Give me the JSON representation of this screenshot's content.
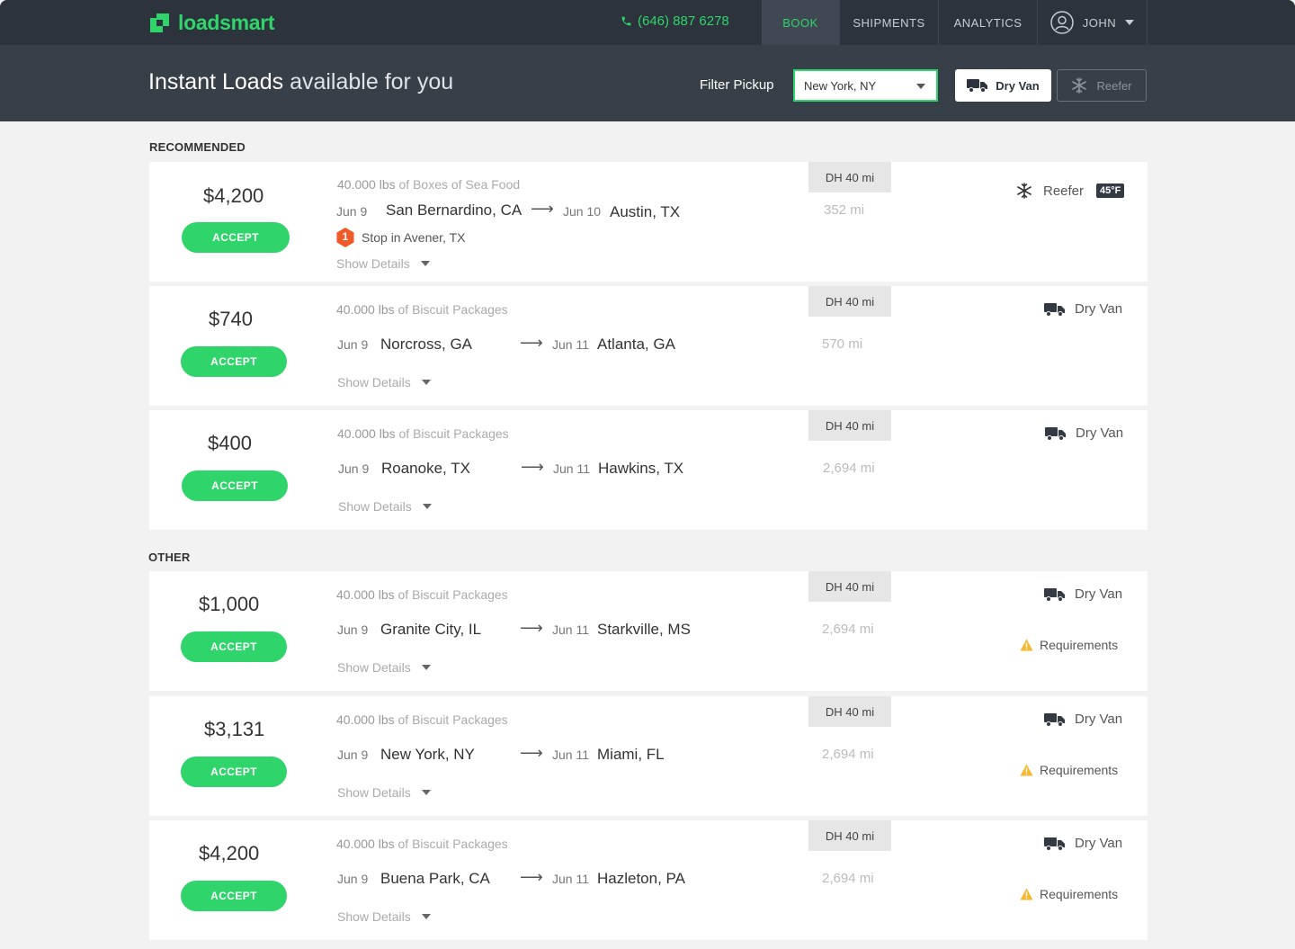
{
  "brand": {
    "name": "loadsmart",
    "color": "#2fd46a"
  },
  "header": {
    "phone": "(646) 887 6278",
    "nav": [
      "BOOK",
      "SHIPMENTS",
      "ANALYTICS"
    ],
    "user": "JOHN",
    "title_main": "Instant Loads",
    "title_rest": " available for you",
    "filter_label": "Filter Pickup",
    "filter_value": "New York, NY",
    "dry_van_label": "Dry Van",
    "reefer_label": "Reefer"
  },
  "sections": {
    "recommended": "RECOMMENDED",
    "other": "OTHER"
  },
  "common": {
    "accept": "ACCEPT",
    "show_details": "Show Details",
    "of": "of"
  },
  "loads": [
    {
      "price": "$4,200",
      "weight": "40.000 lbs",
      "cargo": "Boxes of Sea Food",
      "pickup_date": "Jun 9",
      "pickup_city": "San Bernardino, CA",
      "drop_date": "Jun 10",
      "drop_city": "Austin, TX",
      "stop_count": "1",
      "stop_text": "Stop in Avener, TX",
      "dh": "DH 40 mi",
      "miles": "352 mi",
      "equipment": "Reefer",
      "temp": "45°F",
      "requirements": ""
    },
    {
      "price": "$740",
      "weight": "40.000 lbs",
      "cargo": "Biscuit Packages",
      "pickup_date": "Jun 9",
      "pickup_city": "Norcross, GA",
      "drop_date": "Jun 11",
      "drop_city": "Atlanta, GA",
      "dh": "DH 40 mi",
      "miles": "570 mi",
      "equipment": "Dry Van",
      "requirements": ""
    },
    {
      "price": "$400",
      "weight": "40.000 lbs",
      "cargo": "Biscuit Packages",
      "pickup_date": "Jun 9",
      "pickup_city": "Roanoke, TX",
      "drop_date": "Jun 11",
      "drop_city": "Hawkins, TX",
      "dh": "DH 40 mi",
      "miles": "2,694 mi",
      "equipment": "Dry Van",
      "requirements": ""
    },
    {
      "price": "$1,000",
      "weight": "40.000 lbs",
      "cargo": "Biscuit Packages",
      "pickup_date": "Jun 9",
      "pickup_city": "Granite City, IL",
      "drop_date": "Jun 11",
      "drop_city": "Starkville, MS",
      "dh": "DH 40 mi",
      "miles": "2,694 mi",
      "equipment": "Dry Van",
      "requirements": "Requirements"
    },
    {
      "price": "$3,131",
      "weight": "40.000 lbs",
      "cargo": "Biscuit Packages",
      "pickup_date": "Jun 9",
      "pickup_city": "New York, NY",
      "drop_date": "Jun 11",
      "drop_city": "Miami, FL",
      "dh": "DH 40 mi",
      "miles": "2,694 mi",
      "equipment": "Dry Van",
      "requirements": "Requirements"
    },
    {
      "price": "$4,200",
      "weight": "40.000 lbs",
      "cargo": "Biscuit Packages",
      "pickup_date": "Jun 9",
      "pickup_city": "Buena Park, CA",
      "drop_date": "Jun 11",
      "drop_city": "Hazleton, PA",
      "dh": "DH 40 mi",
      "miles": "2,694 mi",
      "equipment": "Dry Van",
      "requirements": "Requirements"
    }
  ]
}
